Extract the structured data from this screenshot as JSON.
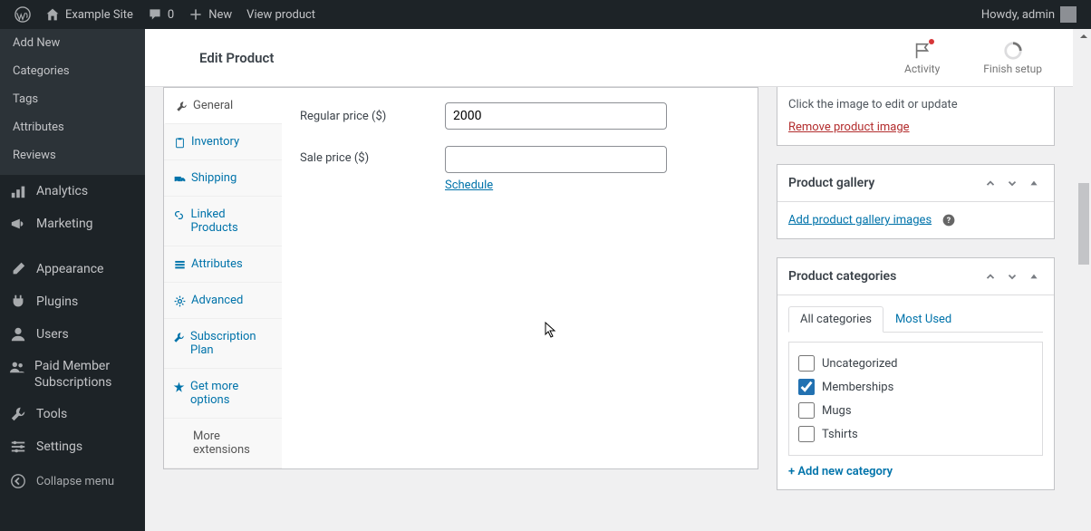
{
  "adminbar": {
    "site_name": "Example Site",
    "comments_count": "0",
    "new_label": "New",
    "view_product": "View product",
    "howdy": "Howdy, admin"
  },
  "leftmenu": {
    "sub": {
      "add_new": "Add New",
      "categories": "Categories",
      "tags": "Tags",
      "attributes": "Attributes",
      "reviews": "Reviews"
    },
    "items": {
      "analytics": "Analytics",
      "marketing": "Marketing",
      "appearance": "Appearance",
      "plugins": "Plugins",
      "users": "Users",
      "pms": "Paid Member Subscriptions",
      "tools": "Tools",
      "settings": "Settings",
      "collapse": "Collapse menu"
    }
  },
  "topbar": {
    "title": "Edit Product",
    "activity": "Activity",
    "finish": "Finish setup"
  },
  "product_tabs": {
    "general": "General",
    "inventory": "Inventory",
    "shipping": "Shipping",
    "linked": "Linked Products",
    "attributes": "Attributes",
    "advanced": "Advanced",
    "subscription": "Subscription Plan",
    "get_more": "Get more options",
    "more_ext": "More extensions"
  },
  "fields": {
    "regular_label": "Regular price ($)",
    "regular_value": "2000",
    "sale_label": "Sale price ($)",
    "sale_value": "",
    "schedule": "Schedule"
  },
  "image_box": {
    "hint": "Click the image to edit or update",
    "remove": "Remove product image"
  },
  "gallery_box": {
    "title": "Product gallery",
    "add": "Add product gallery images"
  },
  "cat_box": {
    "title": "Product categories",
    "tab_all": "All categories",
    "tab_most": "Most Used",
    "items": [
      {
        "label": "Uncategorized",
        "checked": false
      },
      {
        "label": "Memberships",
        "checked": true
      },
      {
        "label": "Mugs",
        "checked": false
      },
      {
        "label": "Tshirts",
        "checked": false
      }
    ],
    "add_new": "+ Add new category"
  }
}
